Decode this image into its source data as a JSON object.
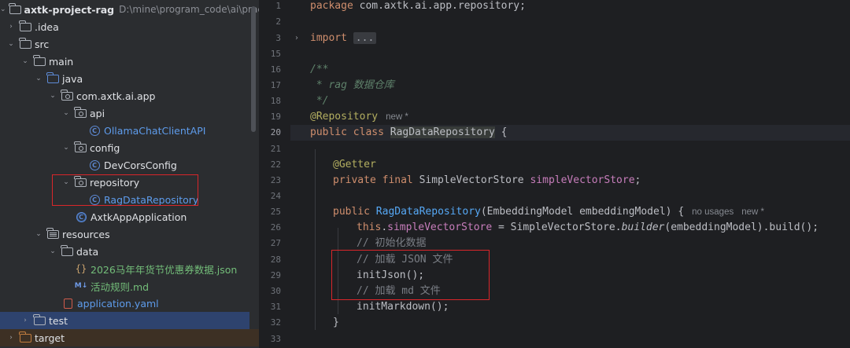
{
  "project": {
    "name": "axtk-project-rag",
    "path": "D:\\mine\\program_code\\ai\\practice\\axtk",
    "items": [
      {
        "label": ".idea"
      },
      {
        "label": "src"
      },
      {
        "label": "main"
      },
      {
        "label": "java"
      },
      {
        "label": "com.axtk.ai.app"
      },
      {
        "label": "api"
      },
      {
        "label": "OllamaChatClientAPI"
      },
      {
        "label": "config"
      },
      {
        "label": "DevCorsConfig"
      },
      {
        "label": "repository"
      },
      {
        "label": "RagDataRepository"
      },
      {
        "label": "AxtkAppApplication"
      },
      {
        "label": "resources"
      },
      {
        "label": "data"
      },
      {
        "label": "2026马年年货节优惠券数据.json"
      },
      {
        "label": "活动规则.md"
      },
      {
        "label": "application.yaml"
      },
      {
        "label": "test"
      },
      {
        "label": "target"
      }
    ]
  },
  "editor": {
    "line_numbers": [
      "1",
      "2",
      "3",
      "15",
      "16",
      "17",
      "18",
      "19",
      "20",
      "21",
      "22",
      "23",
      "24",
      "25",
      "26",
      "27",
      "28",
      "29",
      "30",
      "31",
      "32",
      "33"
    ],
    "lines": {
      "l1_kw": "package",
      "l1_rest": " com.axtk.ai.app.repository;",
      "l3_kw": "import",
      "l3_fold": "...",
      "l16": "/**",
      "l17_a": " * ",
      "l17_b": "rag",
      "l17_c": " 数据仓库",
      "l18": " */",
      "l19_ann": "@Repository",
      "l19_hint": "new *",
      "l20_kw": "public class ",
      "l20_cls": "RagDataRepository",
      "l20_rest": " {",
      "l22_ann": "@Getter",
      "l23_kw": "private final ",
      "l23_type": "SimpleVectorStore ",
      "l23_fld": "simpleVectorStore",
      "l23_end": ";",
      "l25_kw": "public ",
      "l25_fn": "RagDataRepository",
      "l25_rest": "(EmbeddingModel embeddingModel) {",
      "l25_hint1": "no usages",
      "l25_hint2": "new *",
      "l26_this": "this",
      "l26_dot": ".",
      "l26_fld": "simpleVectorStore",
      "l26_mid": " = SimpleVectorStore.",
      "l26_it": "builder",
      "l26_end": "(embeddingModel).build();",
      "l27": "// 初始化数据",
      "l28": "// 加载 JSON 文件",
      "l29": "initJson();",
      "l30": "// 加载 md 文件",
      "l31": "initMarkdown();",
      "l32": "}",
      "l33": ""
    }
  },
  "colors": {
    "keyword": "#cf8e6d",
    "annotation": "#b3ae60",
    "field": "#c77dbb",
    "function": "#56a8f5",
    "comment": "#7a7e85",
    "highlight_box": "#d9262a"
  }
}
